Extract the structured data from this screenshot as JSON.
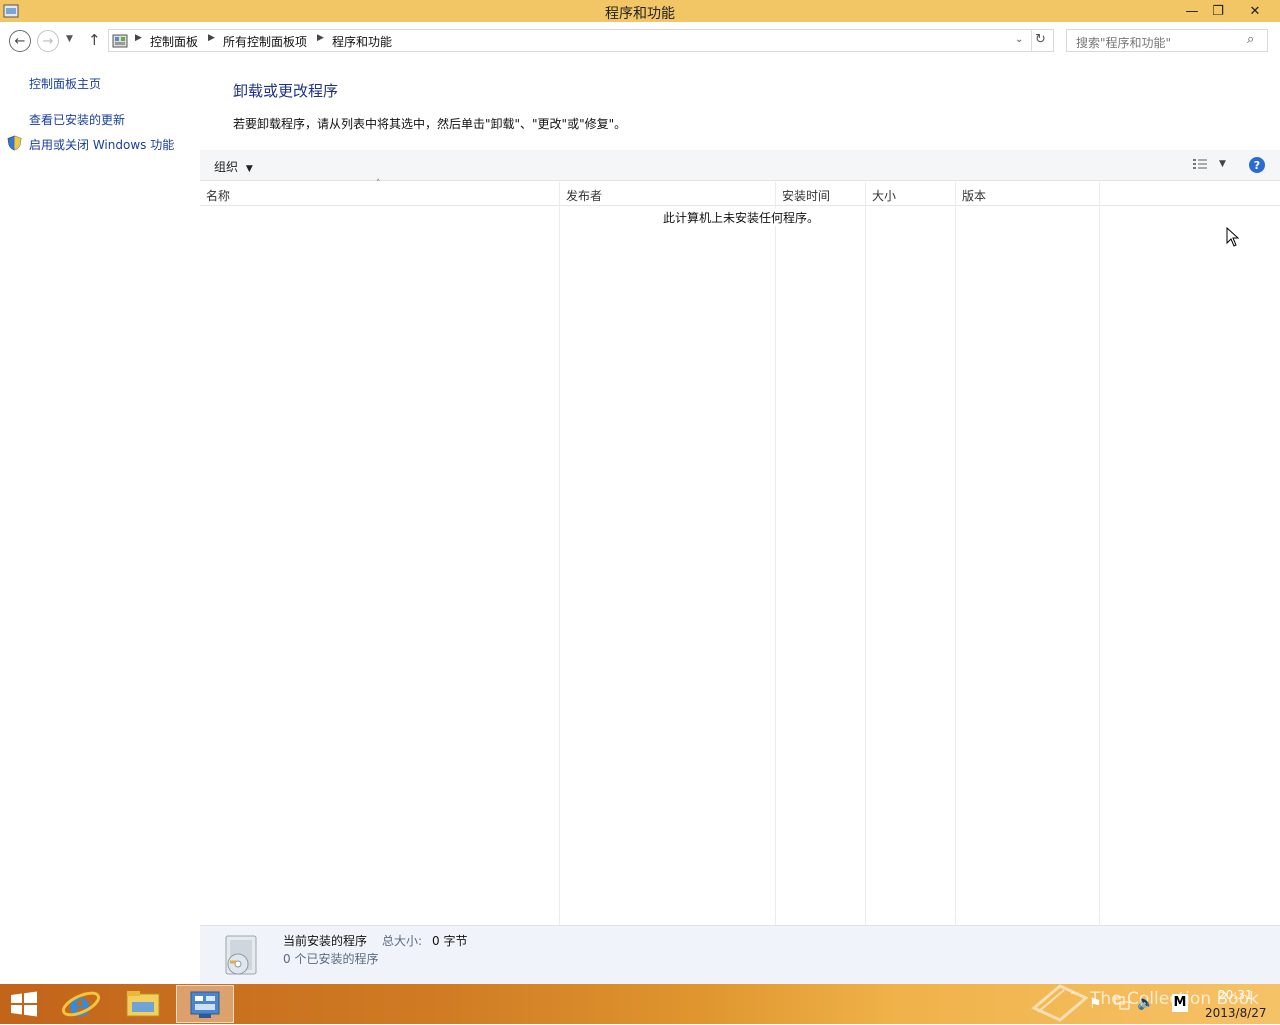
{
  "window": {
    "title": "程序和功能",
    "controls": {
      "minimize": "—",
      "restore": "❐",
      "close": "✕"
    }
  },
  "address": {
    "breadcrumbs": [
      "控制面板",
      "所有控制面板项",
      "程序和功能"
    ],
    "search_placeholder": "搜索\"程序和功能\""
  },
  "sidebar": {
    "items": [
      {
        "label": "控制面板主页"
      },
      {
        "label": "查看已安装的更新"
      },
      {
        "label": "启用或关闭 Windows 功能",
        "icon": "shield-icon"
      }
    ]
  },
  "main": {
    "heading": "卸载或更改程序",
    "description": "若要卸载程序，请从列表中将其选中，然后单击\"卸载\"、\"更改\"或\"修复\"。",
    "toolbar": {
      "organize": "组织"
    },
    "columns": [
      "名称",
      "发布者",
      "安装时间",
      "大小",
      "版本"
    ],
    "empty_message": "此计算机上未安装任何程序。"
  },
  "details": {
    "title": "当前安装的程序",
    "total_size_label": "总大小:",
    "total_size_value": "0 字节",
    "count": "0 个已安装的程序"
  },
  "taskbar": {
    "time": "20:31",
    "date": "2013/8/27",
    "watermark": "The Collection Book"
  },
  "colors": {
    "titlebar": "#f2c565",
    "link": "#1a3e9e",
    "heading": "#1e3287",
    "taskbar_start": "#c2641a",
    "taskbar_end": "#f6c267"
  }
}
